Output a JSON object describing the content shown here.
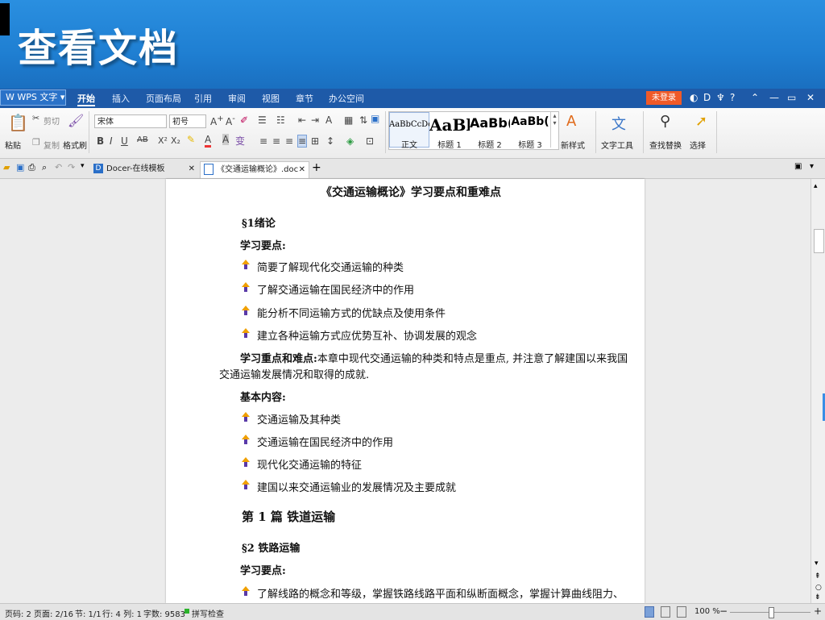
{
  "banner": {
    "title": "查看文档"
  },
  "app": {
    "logo": "W WPS 文字 ▾"
  },
  "menu": {
    "tabs": [
      "开始",
      "插入",
      "页面布局",
      "引用",
      "审阅",
      "视图",
      "章节",
      "办公空间"
    ],
    "login": "未登录",
    "right_icons": [
      "◐",
      "D",
      "♆",
      "?",
      "⌃",
      "—",
      "▭",
      "✕"
    ]
  },
  "ribbon": {
    "paste": "粘贴",
    "cut": "剪切",
    "copy": "复制",
    "format_painter": "格式刷",
    "font_name": "宋体",
    "font_size": "初号",
    "styles": [
      {
        "preview": "AaBbCcDd",
        "name": "正文"
      },
      {
        "preview": "AaBl",
        "name": "标题 1"
      },
      {
        "preview": "AaBb(",
        "name": "标题 2"
      },
      {
        "preview": "AaBb(",
        "name": "标题 3"
      }
    ],
    "new_style": "新样式",
    "text_tools": "文字工具",
    "find_replace": "查找替换",
    "select": "选择"
  },
  "tabbar": {
    "tabs": [
      {
        "label": "Docer-在线模板"
      },
      {
        "label": "《交通运输概论》.doc"
      }
    ],
    "new_tab": "+"
  },
  "document": {
    "title": "《交通运输概论》学习要点和重难点",
    "sec1_heading": "§1绪论",
    "sec1_points_label": "学习要点:",
    "sec1_points": [
      "简要了解现代化交通运输的种类",
      "了解交通运输在国民经济中的作用",
      "能分析不同运输方式的优缺点及使用条件",
      "建立各种运输方式应优势互补、协调发展的观念"
    ],
    "key_label": "学习重点和难点:",
    "key_text_1": "本章中现代交通运输的种类和特点是重点, 并注意了解建国以来我国",
    "key_text_2": "交通运输发展情况和取得的成就.",
    "basic_label": "基本内容:",
    "basic_points": [
      "交通运输及其种类",
      "交通运输在国民经济中的作用",
      "现代化交通运输的特征",
      "建国以来交通运输业的发展情况及主要成就"
    ],
    "part1": "第 1 篇    铁道运输",
    "sec2_heading": "§2 铁路运输",
    "sec2_points_label": "学习要点:",
    "sec2_point_1": "了解线路的概念和等级，掌握铁路线路平面和纵断面概念，掌握计算曲线阻力、"
  },
  "status": {
    "page_no": "页码: 2",
    "pages": "页面: 2/16",
    "section": "节: 1/1",
    "row_col": "行: 4  列: 1",
    "word_count": "字数: 9583",
    "spell_check": "拼写检查",
    "zoom": "100 %"
  },
  "colors": {
    "banner": "#1f7fd2",
    "menubar": "#1e5aa8",
    "login": "#f05a28"
  }
}
